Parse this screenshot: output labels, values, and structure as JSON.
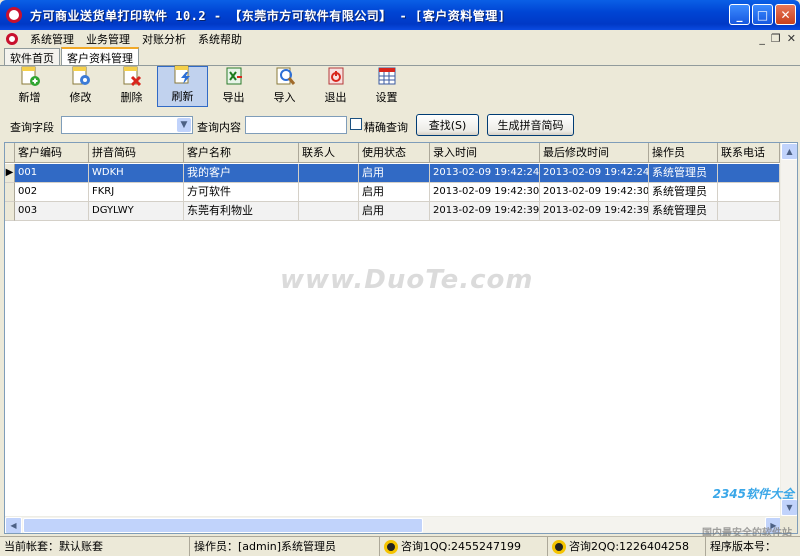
{
  "window": {
    "title": "方可商业送货单打印软件 10.2 - 【东莞市方可软件有限公司】 - [客户资料管理]",
    "min": "_",
    "max": "□",
    "close": "✕"
  },
  "menu": {
    "items": [
      "系统管理",
      "业务管理",
      "对账分析",
      "系统帮助"
    ],
    "mdi_min": "_",
    "mdi_restore": "❐",
    "mdi_close": "✕"
  },
  "tabs": [
    {
      "label": "软件首页",
      "active": false
    },
    {
      "label": "客户资料管理",
      "active": true
    }
  ],
  "toolbar": [
    {
      "label": "新增",
      "icon": "add-icon"
    },
    {
      "label": "修改",
      "icon": "edit-icon"
    },
    {
      "label": "删除",
      "icon": "delete-icon"
    },
    {
      "label": "刷新",
      "icon": "refresh-icon"
    },
    {
      "label": "导出",
      "icon": "export-excel-icon"
    },
    {
      "label": "导入",
      "icon": "import-icon"
    },
    {
      "label": "退出",
      "icon": "exit-icon"
    },
    {
      "label": "设置",
      "icon": "settings-icon"
    }
  ],
  "search": {
    "field_label": "查询字段",
    "field_value": "",
    "content_label": "查询内容",
    "content_value": "",
    "exact_label": "精确查询",
    "exact_checked": false,
    "find_button": "查找(S)",
    "pinyin_button": "生成拼音简码"
  },
  "table": {
    "columns": [
      "客户编码",
      "拼音简码",
      "客户名称",
      "联系人",
      "使用状态",
      "录入时间",
      "最后修改时间",
      "操作员",
      "联系电话"
    ],
    "rows": [
      [
        "001",
        "WDKH",
        "我的客户",
        "",
        "启用",
        "2013-02-09 19:42:24",
        "2013-02-09 19:42:24",
        "系统管理员",
        ""
      ],
      [
        "002",
        "FKRJ",
        "方可软件",
        "",
        "启用",
        "2013-02-09 19:42:30",
        "2013-02-09 19:42:30",
        "系统管理员",
        ""
      ],
      [
        "003",
        "DGYLWY",
        "东莞有利物业",
        "",
        "启用",
        "2013-02-09 19:42:39",
        "2013-02-09 19:42:39",
        "系统管理员",
        ""
      ]
    ],
    "selected_row": 0
  },
  "watermarks": {
    "main": "www.DuoTe.com",
    "brand": "2345软件大全",
    "slogan": "国内最安全的软件站"
  },
  "status": {
    "account": "当前帐套：默认账套",
    "operator": "操作员：[admin]系统管理员",
    "qq1": "咨询1QQ:2455247199",
    "qq2": "咨询2QQ:1226404258",
    "version": "程序版本号："
  },
  "colors": {
    "titlebar": "#0045d4",
    "selection": "#316ac5",
    "window_bg": "#ece9d8"
  }
}
